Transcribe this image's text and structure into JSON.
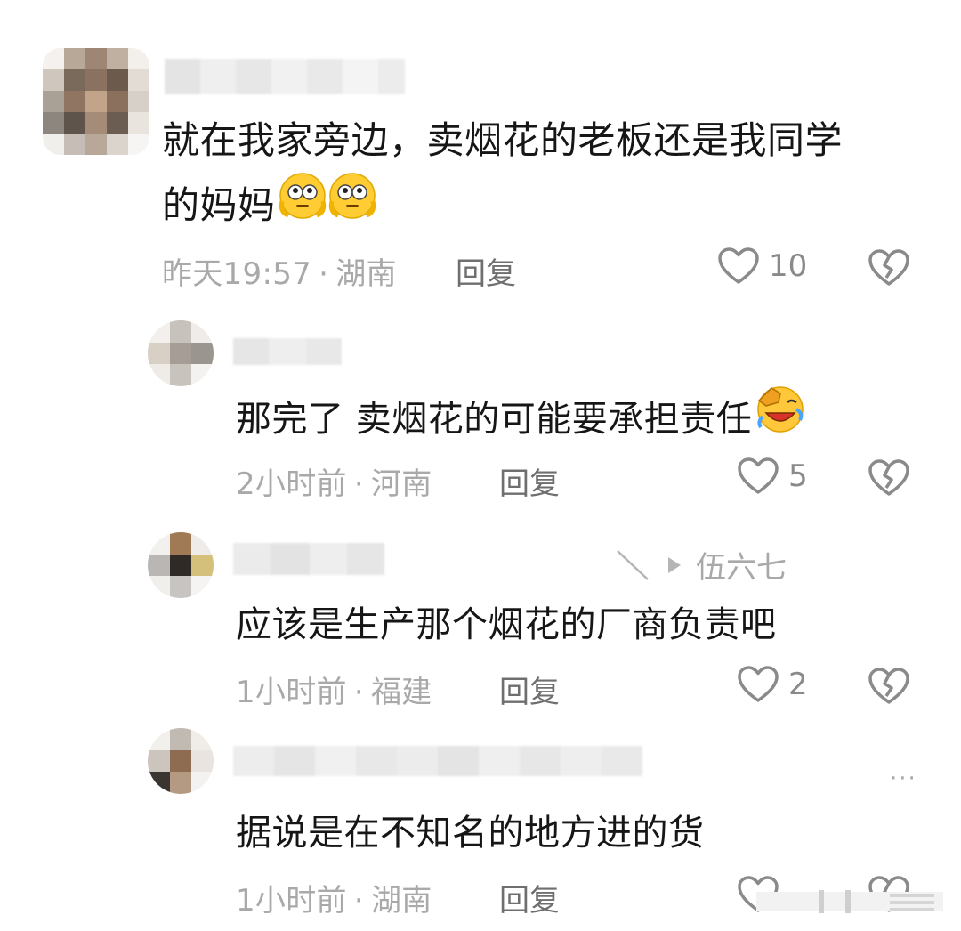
{
  "comments": [
    {
      "text_line1": "就在我家旁边，卖烟花的老板还是我同学",
      "text_line2": "的妈妈",
      "emojis": [
        "shocked-eyes-emoji",
        "shocked-eyes-emoji"
      ],
      "time": "昨天19:57",
      "location": "湖南",
      "reply_label": "回复",
      "likes": "10"
    },
    {
      "text": "那完了 卖烟花的可能要承担责任",
      "emoji": "facepalm-laugh-emoji",
      "time": "2小时前",
      "location": "河南",
      "reply_label": "回复",
      "likes": "5"
    },
    {
      "reply_to": "伍六七",
      "text": "应该是生产那个烟花的厂商负责吧",
      "time": "1小时前",
      "location": "福建",
      "reply_label": "回复",
      "likes": "2"
    },
    {
      "text": "据说是在不知名的地方进的货",
      "time": "1小时前",
      "location": "湖南",
      "reply_label": "回复",
      "more": "···"
    }
  ],
  "separator": "·",
  "colors": {
    "text": "#161616",
    "meta": "#a9a9a9",
    "icon": "#8a8a8a",
    "background": "#ffffff"
  }
}
